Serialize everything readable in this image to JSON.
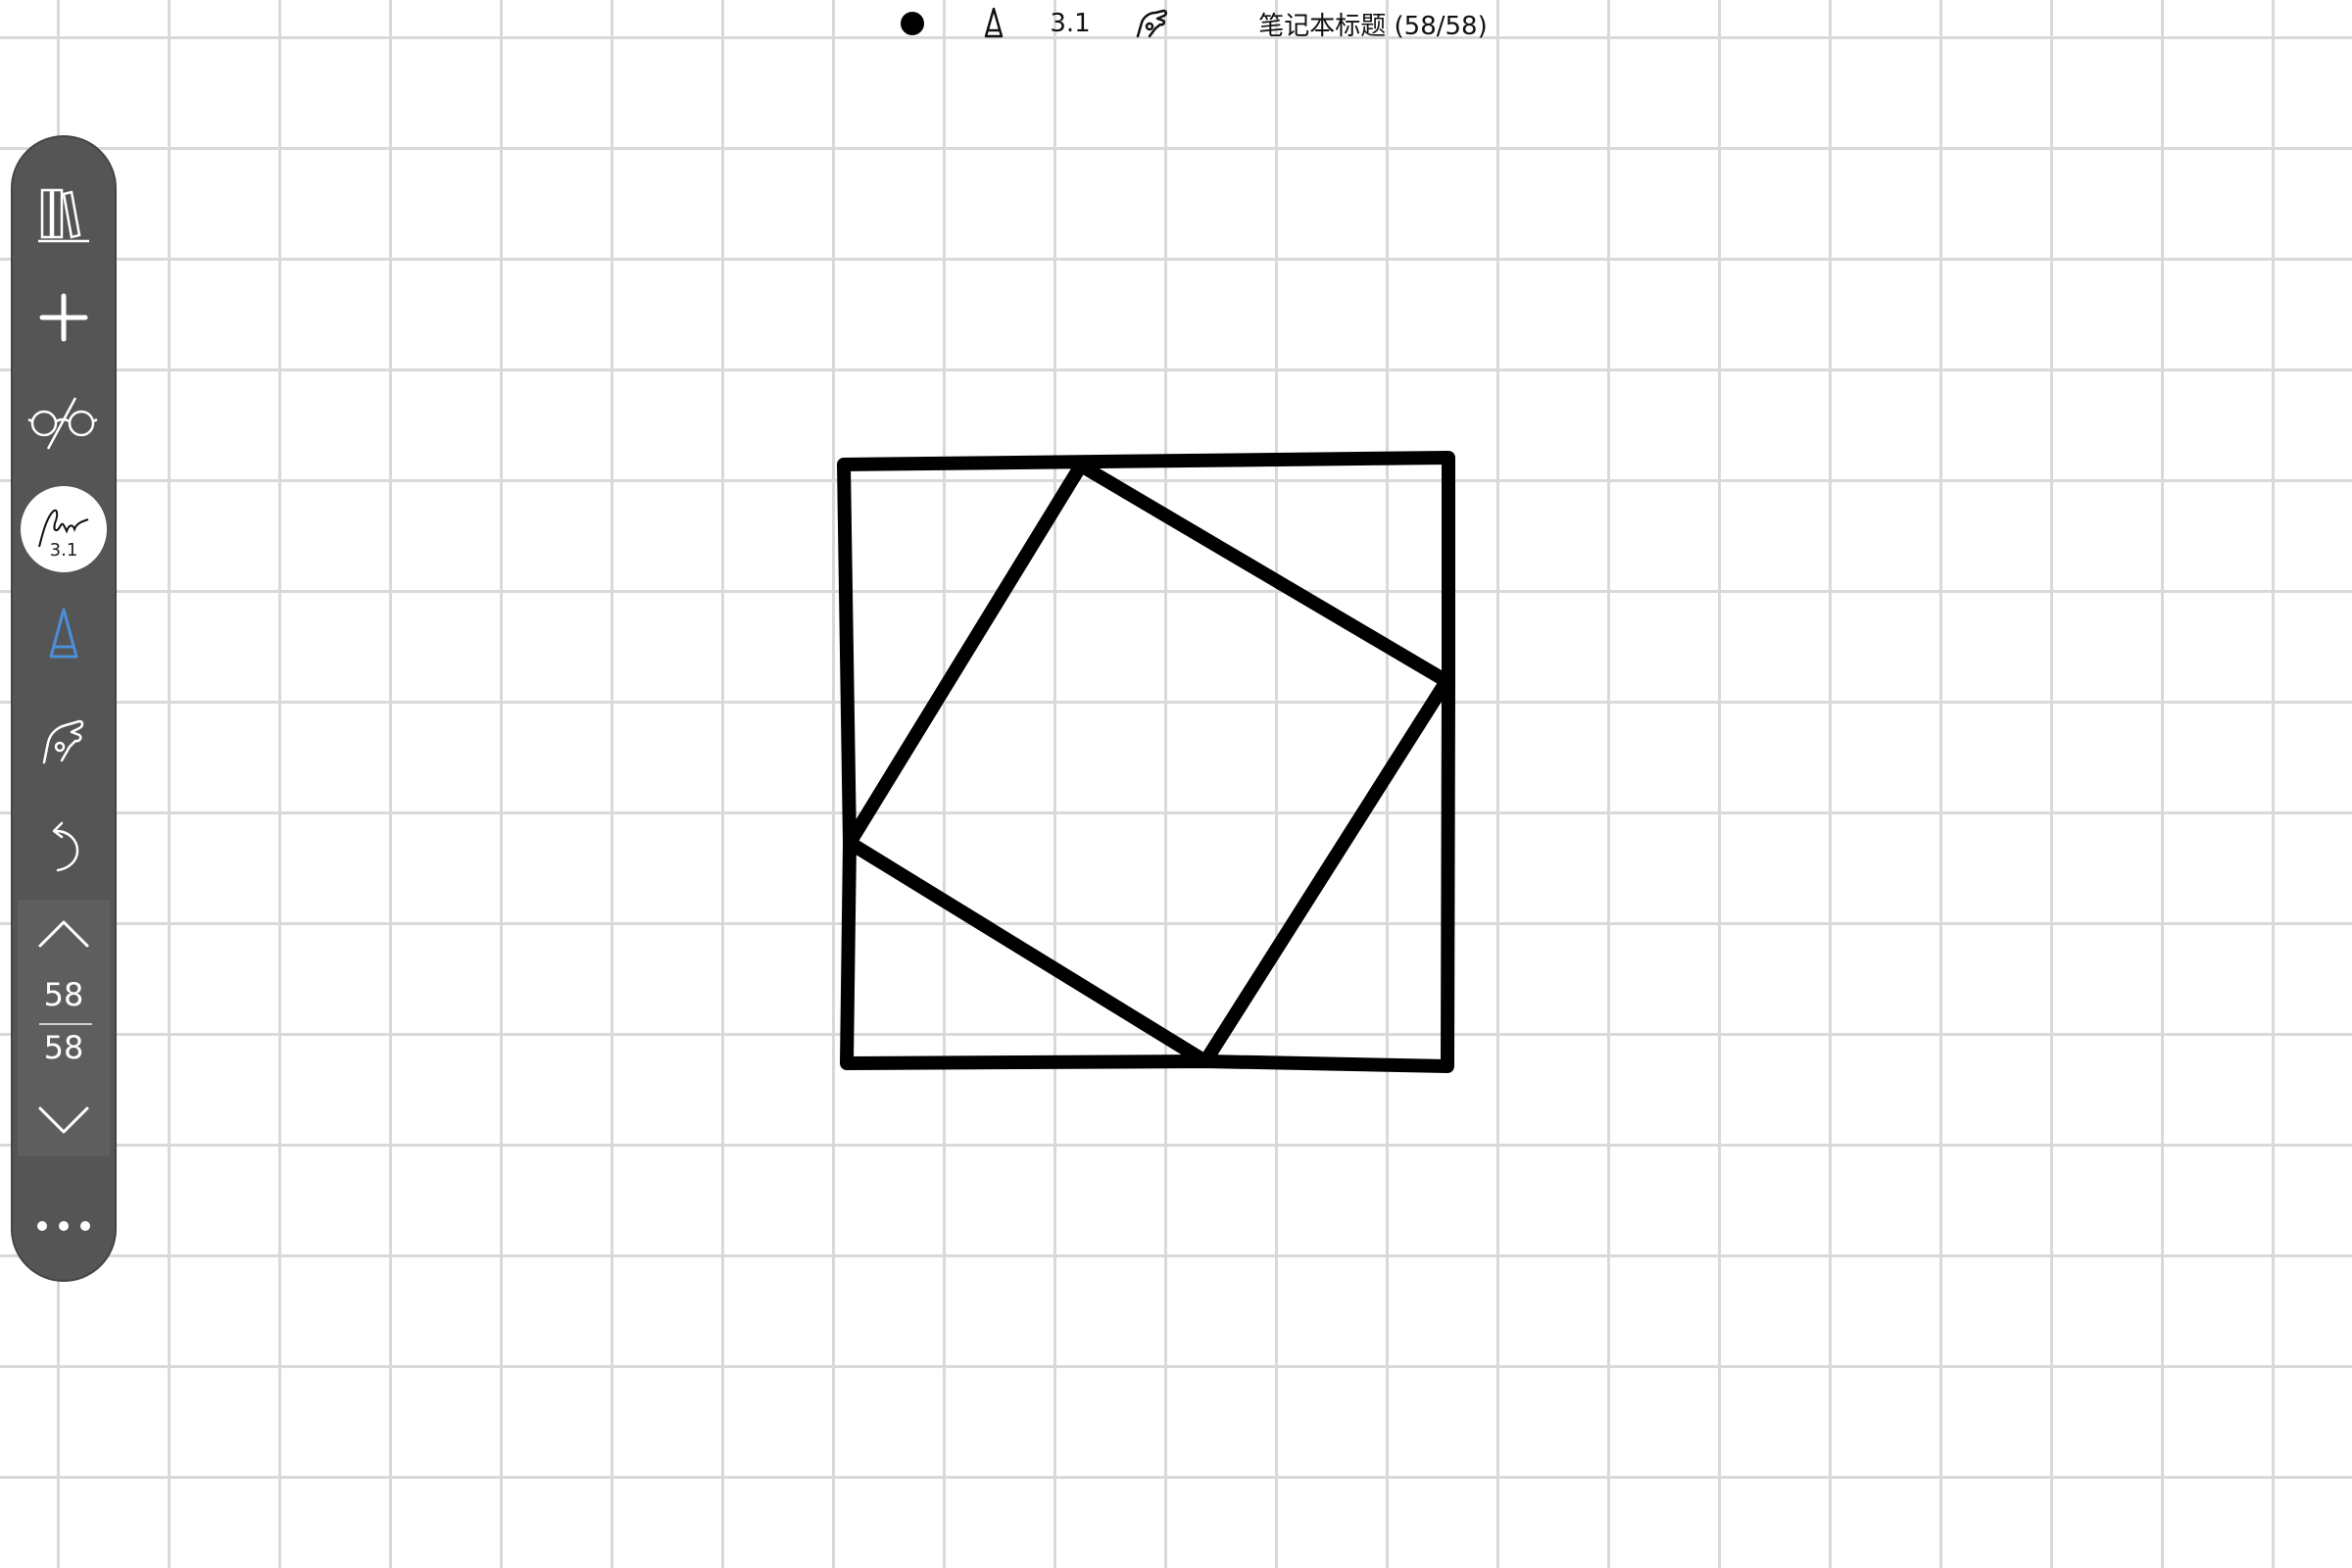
{
  "status_bar": {
    "pen_width": "3.1",
    "notebook_title": "笔记本标题 (58/58)"
  },
  "sidebar": {
    "items": [
      {
        "icon": "library-icon"
      },
      {
        "icon": "plus-icon"
      },
      {
        "icon": "glasses-icon"
      },
      {
        "icon": "signature-pen-size-icon",
        "label": "3.1"
      },
      {
        "icon": "pen-nib-icon",
        "color": "#4a90d9"
      },
      {
        "icon": "hand-pointer-icon"
      },
      {
        "icon": "undo-icon"
      }
    ],
    "page_nav": {
      "current": "58",
      "total": "58"
    },
    "more_icon": "more-icon"
  },
  "colors": {
    "sidebar_bg": "#555555",
    "grid_line": "#d9d9d9",
    "ink": "#000000",
    "active_tool": "#4a90d9"
  }
}
